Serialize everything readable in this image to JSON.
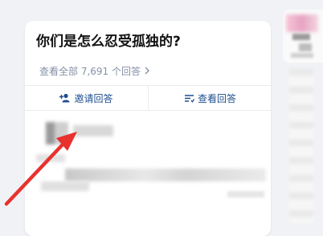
{
  "question": {
    "title": "你们是怎么忍受孤独的?",
    "answers_link": "查看全部 7,691 个回答",
    "chevron_icon": "chevron-right-icon"
  },
  "actions": {
    "invite_label": "邀请回答",
    "invite_icon": "add-user-icon",
    "view_label": "查看回答",
    "view_icon": "list-icon"
  },
  "colors": {
    "accent": "#1d4d8e",
    "muted": "#8590a6",
    "annotation_arrow": "#e8322e",
    "background": "#f1f2f5"
  }
}
